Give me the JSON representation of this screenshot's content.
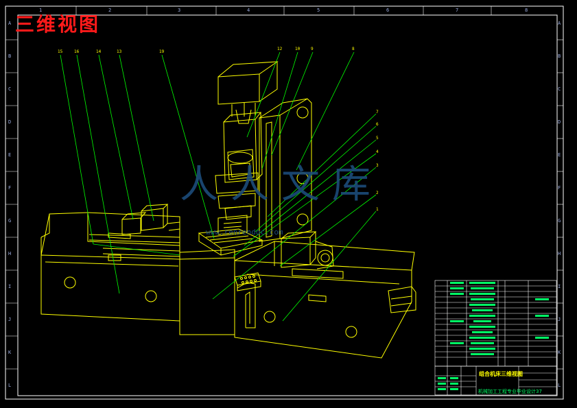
{
  "drawing": {
    "title": "三维视图",
    "column_zones": [
      "1",
      "2",
      "3",
      "4",
      "5",
      "6",
      "7",
      "8"
    ],
    "row_zones": [
      "A",
      "B",
      "C",
      "D",
      "E",
      "F",
      "G",
      "H",
      "I",
      "J",
      "K",
      "L"
    ],
    "callouts": [
      "15",
      "16",
      "14",
      "13",
      "19",
      "12",
      "10",
      "9",
      "8",
      "7",
      "6",
      "5",
      "4",
      "3",
      "2",
      "1"
    ]
  },
  "title_block": {
    "drawing_name": "组合机床三维视图",
    "school": "机械加工工程专业毕业设计37"
  },
  "watermark": {
    "text": "人人文库",
    "url": "www.renrendoc.com"
  },
  "colors": {
    "background": "#000000",
    "geometry": "#ffff00",
    "leaders": "#00ff00",
    "frame": "#ffffff",
    "title": "#ff1a1a",
    "watermark": "#1c4c7a"
  }
}
